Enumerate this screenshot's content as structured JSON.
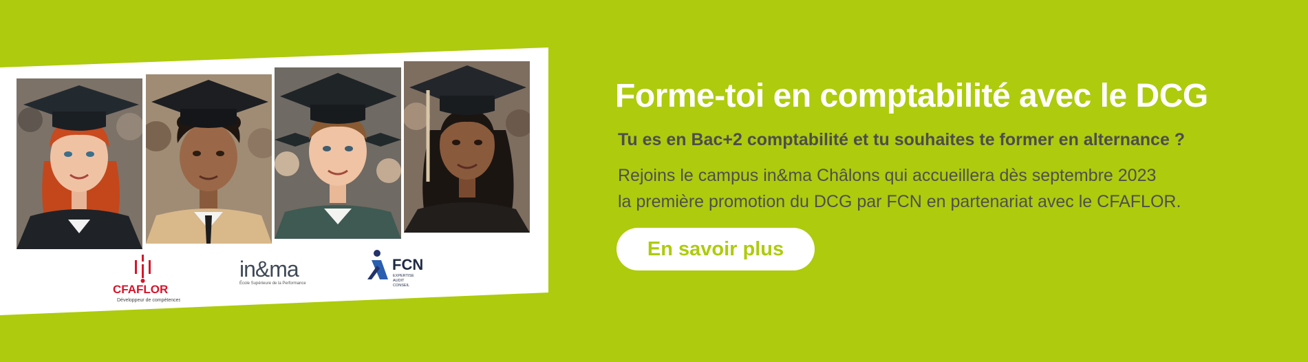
{
  "colors": {
    "accent": "#aecb0d",
    "text_dark": "#4d4d4d",
    "white": "#ffffff"
  },
  "banner": {
    "heading": "Forme-toi en comptabilité avec le DCG",
    "subheading": "Tu es en Bac+2 comptabilité et tu souhaites te former en alternance ?",
    "description_lines": [
      "Rejoins le campus in&ma Châlons qui accueillera dès septembre 2023",
      "la première promotion du DCG par FCN en partenariat avec le CFAFLOR."
    ],
    "cta_label": "En savoir plus"
  },
  "logos": {
    "cfaflor": {
      "name": "CFAFLOR",
      "tagline": "Développeur de compétences"
    },
    "inma": {
      "name": "in&ma",
      "tagline": "École Supérieure de la Performance"
    },
    "fcn": {
      "name": "FCN",
      "tagline_lines": [
        "EXPERTISE",
        "AUDIT",
        "CONSEIL"
      ]
    }
  },
  "photos": [
    "graduate-photo-1",
    "graduate-photo-2",
    "graduate-photo-3",
    "graduate-photo-4"
  ]
}
